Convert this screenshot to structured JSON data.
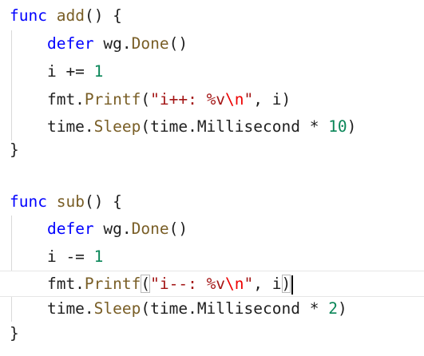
{
  "colors": {
    "keyword": "#0000ff",
    "function": "#795e26",
    "number": "#098658",
    "string": "#a31515",
    "escape": "#ee0000",
    "plain": "#1f1f1f"
  },
  "code": {
    "lines": [
      [
        {
          "t": "func",
          "c": "kw"
        },
        {
          "t": " ",
          "c": "pl"
        },
        {
          "t": "add",
          "c": "fn"
        },
        {
          "t": "() {",
          "c": "pl"
        }
      ],
      [
        {
          "t": "    ",
          "c": "pl"
        },
        {
          "t": "defer",
          "c": "kw"
        },
        {
          "t": " wg.",
          "c": "pl"
        },
        {
          "t": "Done",
          "c": "fn"
        },
        {
          "t": "()",
          "c": "pl"
        }
      ],
      [
        {
          "t": "    i += ",
          "c": "pl"
        },
        {
          "t": "1",
          "c": "num"
        }
      ],
      [
        {
          "t": "    fmt.",
          "c": "pl"
        },
        {
          "t": "Printf",
          "c": "fn"
        },
        {
          "t": "(",
          "c": "pl"
        },
        {
          "t": "\"i++: %v",
          "c": "str"
        },
        {
          "t": "\\n",
          "c": "esc"
        },
        {
          "t": "\"",
          "c": "str"
        },
        {
          "t": ", i)",
          "c": "pl"
        }
      ],
      [
        {
          "t": "    time.",
          "c": "pl"
        },
        {
          "t": "Sleep",
          "c": "fn"
        },
        {
          "t": "(time.Millisecond * ",
          "c": "pl"
        },
        {
          "t": "10",
          "c": "num"
        },
        {
          "t": ")",
          "c": "pl"
        }
      ],
      [
        {
          "t": "}",
          "c": "pl"
        }
      ],
      [],
      [
        {
          "t": "func",
          "c": "kw"
        },
        {
          "t": " ",
          "c": "pl"
        },
        {
          "t": "sub",
          "c": "fn"
        },
        {
          "t": "() {",
          "c": "pl"
        }
      ],
      [
        {
          "t": "    ",
          "c": "pl"
        },
        {
          "t": "defer",
          "c": "kw"
        },
        {
          "t": " wg.",
          "c": "pl"
        },
        {
          "t": "Done",
          "c": "fn"
        },
        {
          "t": "()",
          "c": "pl"
        }
      ],
      [
        {
          "t": "    i -= ",
          "c": "pl"
        },
        {
          "t": "1",
          "c": "num"
        }
      ],
      [
        {
          "t": "    fmt.",
          "c": "pl"
        },
        {
          "t": "Printf",
          "c": "fn"
        },
        {
          "t": "(",
          "c": "pl",
          "hl": true
        },
        {
          "t": "\"i--: %v",
          "c": "str"
        },
        {
          "t": "\\n",
          "c": "esc"
        },
        {
          "t": "\"",
          "c": "str"
        },
        {
          "t": ", i",
          "c": "pl"
        },
        {
          "t": ")",
          "c": "pl",
          "hl": true
        },
        {
          "t": "",
          "c": "caret"
        }
      ],
      [
        {
          "t": "    time.",
          "c": "pl"
        },
        {
          "t": "Sleep",
          "c": "fn"
        },
        {
          "t": "(time.Millisecond * ",
          "c": "pl"
        },
        {
          "t": "2",
          "c": "num"
        },
        {
          "t": ")",
          "c": "pl"
        }
      ],
      [
        {
          "t": "}",
          "c": "pl"
        }
      ]
    ],
    "current_line_index": 10
  }
}
